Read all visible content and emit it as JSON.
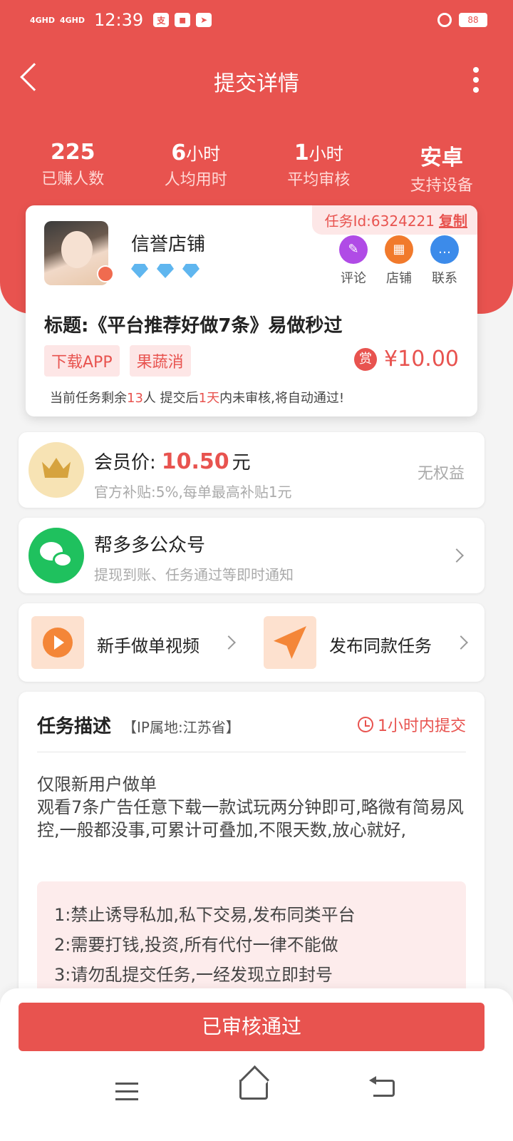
{
  "status": {
    "signal1": "4GHD",
    "signal2": "4GHD",
    "time": "12:39",
    "battery": "88"
  },
  "nav": {
    "title": "提交详情"
  },
  "stats": [
    {
      "value": "225",
      "unit": "",
      "label": "已赚人数"
    },
    {
      "value": "6",
      "unit": "小时",
      "label": "人均用时"
    },
    {
      "value": "1",
      "unit": "小时",
      "label": "平均审核"
    },
    {
      "value": "安卓",
      "unit": "",
      "label": "支持设备"
    }
  ],
  "task": {
    "id_text": "任务Id:6324221",
    "copy_label": "复制",
    "shop_name": "信誉店铺",
    "diamond_count": 3,
    "actions": [
      {
        "label": "评论",
        "icon": "comment-icon"
      },
      {
        "label": "店铺",
        "icon": "shop-icon"
      },
      {
        "label": "联系",
        "icon": "chat-icon"
      }
    ],
    "title": "标题:《平台推荐好做7条》易做秒过",
    "tags": [
      "下载APP",
      "果蔬消"
    ],
    "reward_badge": "赏",
    "reward": "¥10.00",
    "remain_prefix": "当前任务剩余",
    "remain_count": "13",
    "remain_mid": "人  提交后",
    "remain_days": "1天",
    "remain_suffix": "内未审核,将自动通过!"
  },
  "member": {
    "label": "会员价:",
    "price": "10.50",
    "unit": "元",
    "sub": "官方补贴:5%,每单最高补贴1元",
    "rights": "无权益"
  },
  "wechat": {
    "label": "帮多多公众号",
    "sub": "提现到账、任务通过等即时通知"
  },
  "quick": {
    "video_label": "新手做单视频",
    "publish_label": "发布同款任务"
  },
  "description": {
    "title": "任务描述",
    "ip": "【IP属地:江苏省】",
    "deadline": "1小时内提交",
    "line1": "仅限新用户做单",
    "line2": "观看7条广告任意下载一款试玩两分钟即可,略微有简易风控,一般都没事,可累计可叠加,不限天数,放心就好,",
    "rules": [
      "1:禁止诱导私加,私下交易,发布同类平台",
      "2:需要打钱,投资,所有代付一律不能做",
      "3:请勿乱提交任务,一经发现立即封号"
    ]
  },
  "bottom": {
    "button_label": "已审核通过"
  },
  "colors": {
    "brand_red": "#e8534f",
    "member_gold": "#d6a33e",
    "wechat_green": "#1fc15e"
  }
}
